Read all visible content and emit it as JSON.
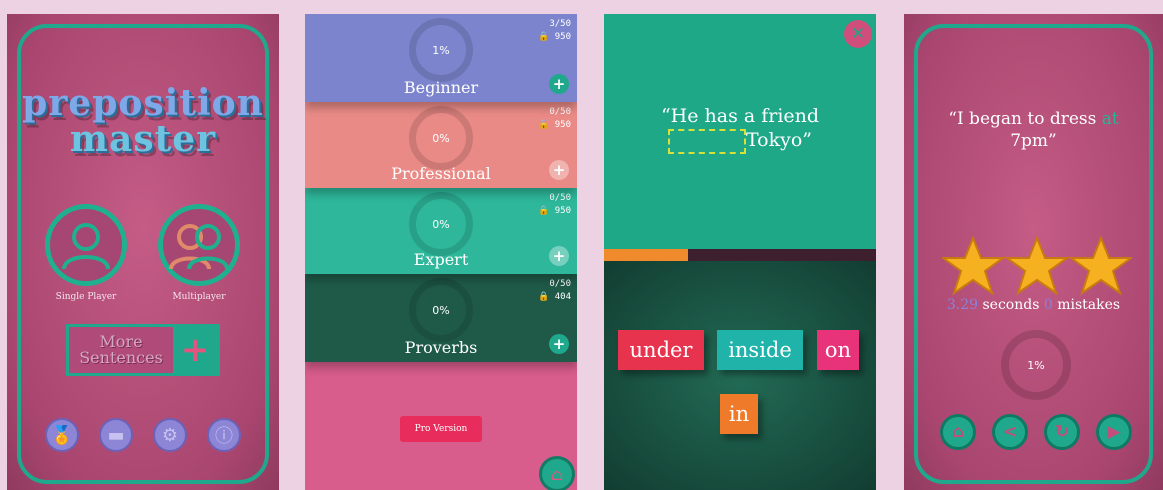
{
  "screen1": {
    "logo_line1": "preposition",
    "logo_line2": "master",
    "single_player_label": "Single Player",
    "multiplayer_label": "Multiplayer",
    "more_button_line1": "More",
    "more_button_line2": "Sentences",
    "more_button_icon": "+"
  },
  "screen2": {
    "levels": [
      {
        "name": "Beginner",
        "percent": "1%",
        "progress": "3/50",
        "coins": "950",
        "color": "#7b84cc"
      },
      {
        "name": "Professional",
        "percent": "0%",
        "progress": "0/50",
        "coins": "950",
        "color": "#e98a86"
      },
      {
        "name": "Expert",
        "percent": "0%",
        "progress": "0/50",
        "coins": "950",
        "color": "#2eb79a"
      },
      {
        "name": "Proverbs",
        "percent": "0%",
        "progress": "0/50",
        "coins": "404",
        "color": "#1f5a48"
      }
    ],
    "pro_button": "Pro Version"
  },
  "screen3": {
    "sentence_before": "“He has a friend",
    "sentence_after": "Tokyo”",
    "time_progress": 0.31,
    "choices": [
      "under",
      "inside",
      "on",
      "in"
    ],
    "colors": {
      "under": "#e8334f",
      "inside": "#1fb3a9",
      "on": "#e8337a",
      "in": "#ee7a2a"
    }
  },
  "screen4": {
    "quote_before": "“I began to dress ",
    "quote_highlight": "at",
    "quote_after": "7pm”",
    "time_value": "3.29",
    "time_unit": " seconds ",
    "mistakes_value": "0",
    "mistakes_unit": " mistakes",
    "percent": "1%",
    "stars": 3
  },
  "colors": {
    "accent": "#1fa88c",
    "magenta": "#a9466f",
    "orange": "#ef8a2d"
  },
  "icons": [
    "trophy-icon",
    "leaderboard-icon",
    "settings-icon",
    "info-icon",
    "home-icon",
    "share-icon",
    "replay-icon",
    "play-icon",
    "close-icon",
    "lock-icon",
    "plus-icon"
  ]
}
